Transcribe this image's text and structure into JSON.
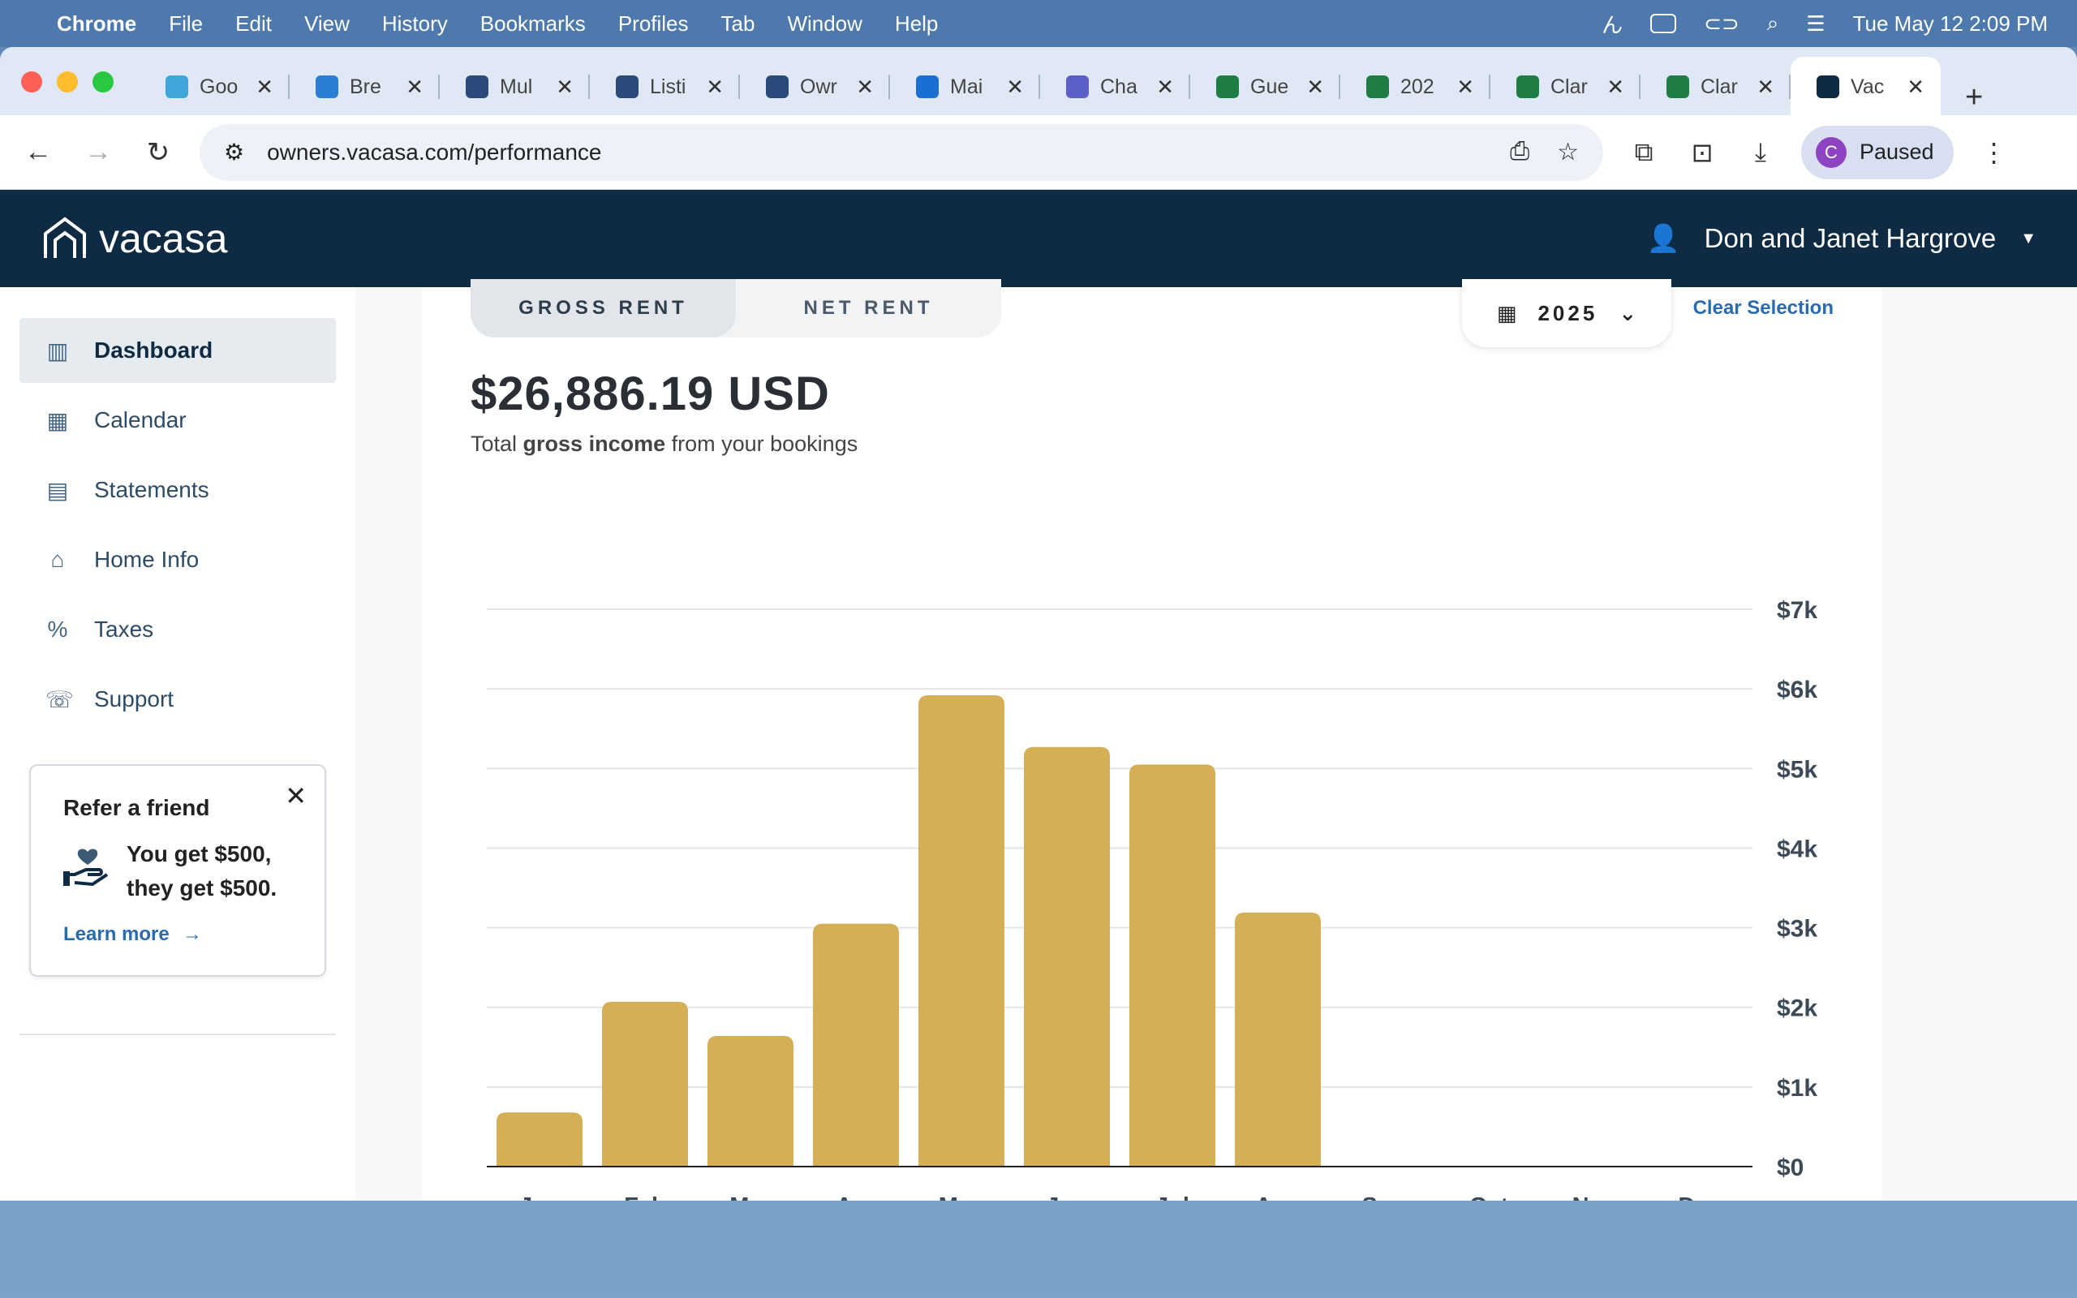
{
  "menubar": {
    "app": "Chrome",
    "items": [
      "File",
      "Edit",
      "View",
      "History",
      "Bookmarks",
      "Profiles",
      "Tab",
      "Window",
      "Help"
    ],
    "clock": "Tue May 12  2:09 PM"
  },
  "tabs": [
    {
      "label": "Goo",
      "color": "#3ea7d8"
    },
    {
      "label": "Bre",
      "color": "#2a7fd4"
    },
    {
      "label": "Mul",
      "color": "#2b4a7a"
    },
    {
      "label": "Listi",
      "color": "#2b4a7a"
    },
    {
      "label": "Owr",
      "color": "#2b4a7a"
    },
    {
      "label": "Mai",
      "color": "#1b6fd1"
    },
    {
      "label": "Cha",
      "color": "#5b5fc7"
    },
    {
      "label": "Gue",
      "color": "#1e7d45"
    },
    {
      "label": "202",
      "color": "#1e7d45"
    },
    {
      "label": "Clar",
      "color": "#1e7d45"
    },
    {
      "label": "Clar",
      "color": "#1e7d45"
    },
    {
      "label": "Vac",
      "color": "#0f2b44"
    }
  ],
  "address": {
    "url": "owners.vacasa.com/performance"
  },
  "profile": {
    "initial": "C",
    "label": "Paused"
  },
  "vacasa": {
    "logo": "vacasa",
    "user": "Don and Janet Hargrove"
  },
  "sidebar": {
    "items": [
      {
        "label": "Dashboard",
        "icon": "bar-chart-icon"
      },
      {
        "label": "Calendar",
        "icon": "calendar-icon"
      },
      {
        "label": "Statements",
        "icon": "document-icon"
      },
      {
        "label": "Home Info",
        "icon": "home-icon"
      },
      {
        "label": "Taxes",
        "icon": "percent-icon"
      },
      {
        "label": "Support",
        "icon": "support-icon"
      }
    ],
    "refer": {
      "title": "Refer a friend",
      "line1": "You get $500,",
      "line2": "they get $500.",
      "link": "Learn more"
    }
  },
  "performance": {
    "toggle_gross": "GROSS RENT",
    "toggle_net": "NET RENT",
    "year": "2025",
    "clear": "Clear Selection",
    "total": "$26,886.19 USD",
    "sub_pre": "Total ",
    "sub_bold": "gross income",
    "sub_post": " from your bookings"
  },
  "chart_data": {
    "type": "bar",
    "categories": [
      "Jan",
      "Feb",
      "Mar",
      "Apr",
      "May",
      "Jun",
      "Jul",
      "Aug",
      "Sep",
      "Oct",
      "Nov",
      "Dec"
    ],
    "values": [
      680,
      2070,
      1640,
      3050,
      5920,
      5270,
      5050,
      3190,
      0,
      0,
      0,
      0
    ],
    "y_ticks": [
      "$0",
      "$1k",
      "$2k",
      "$3k",
      "$4k",
      "$5k",
      "$6k",
      "$7k"
    ],
    "ylim": [
      0,
      7000
    ],
    "bar_color": "#d4af56",
    "grid": true
  }
}
